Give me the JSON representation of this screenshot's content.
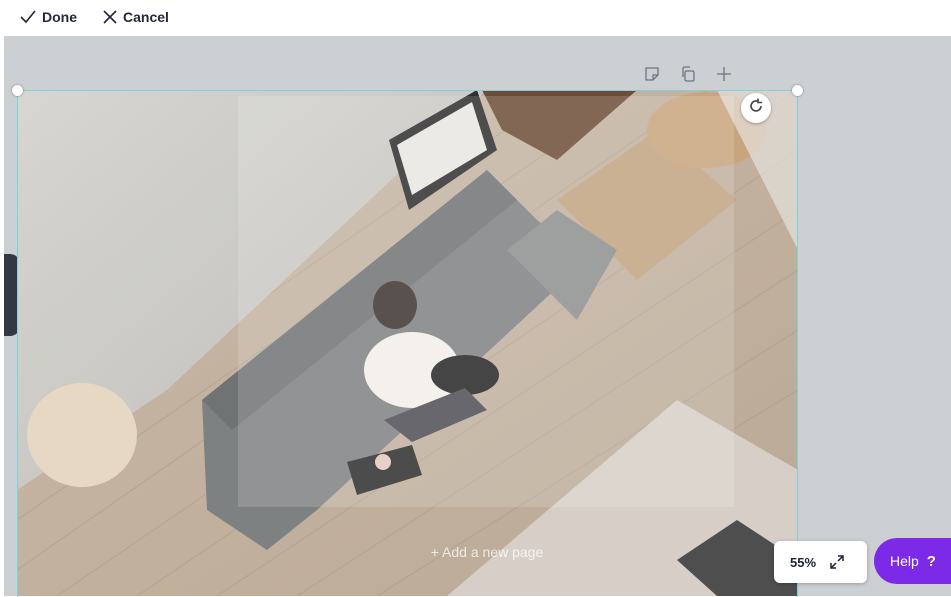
{
  "toolbar": {
    "done_label": "Done",
    "cancel_label": "Cancel"
  },
  "page_tools": {
    "icons": [
      "note-icon",
      "duplicate-icon",
      "add-icon"
    ]
  },
  "canvas": {
    "add_page_label": "+ Add a new page"
  },
  "zoom": {
    "value": "55%"
  },
  "help": {
    "label": "Help",
    "symbol": "?"
  },
  "colors": {
    "accent": "#7d2ae8",
    "selection": "#7fd1dc",
    "canvas_bg": "#cdd0d3",
    "side_tab": "#2f3542"
  }
}
